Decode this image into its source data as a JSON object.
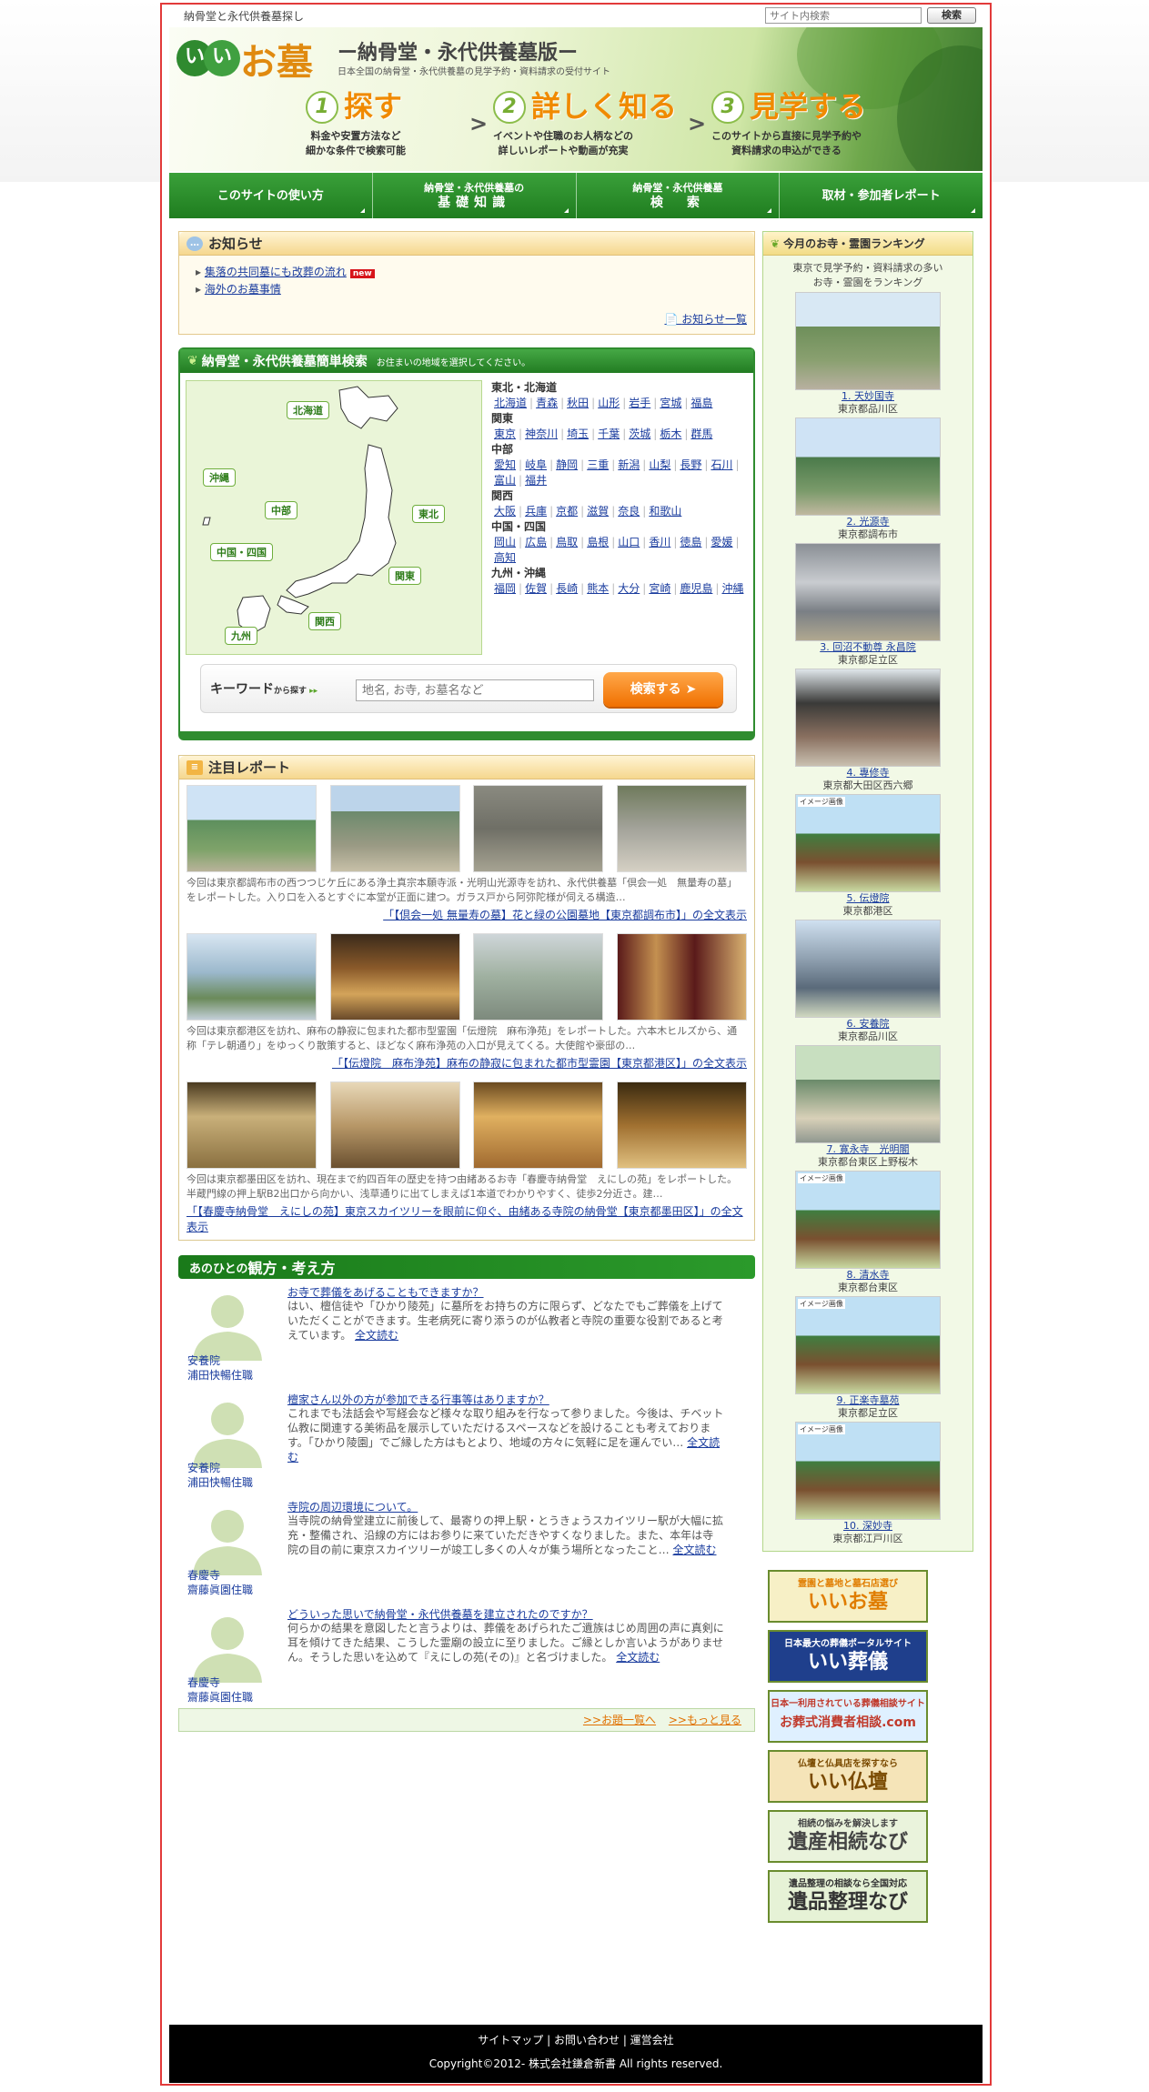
{
  "topbar": {
    "tagline": "納骨堂と永代供養墓探し",
    "search_placeholder": "サイト内検索",
    "search_button": "検索"
  },
  "header": {
    "logo_circle": "いい",
    "logo_text": "お墓",
    "subtitle": "ー納骨堂・永代供養墓版ー",
    "description": "日本全国の納骨堂・永代供養墓の見学予約・資料請求の受付サイト",
    "steps": [
      {
        "num": "1",
        "title": "探す",
        "desc1": "料金や安置方法など",
        "desc2": "細かな条件で検索可能"
      },
      {
        "num": "2",
        "title": "詳しく知る",
        "desc1": "イベントや住職のお人柄などの",
        "desc2": "詳しいレポートや動画が充実"
      },
      {
        "num": "3",
        "title": "見学する",
        "desc1": "このサイトから直接に見学予約や",
        "desc2": "資料請求の申込ができる"
      }
    ]
  },
  "gnav": [
    {
      "l1": "このサイトの使い方",
      "l2": ""
    },
    {
      "l1": "納骨堂・永代供養墓の",
      "l2": "基礎知識"
    },
    {
      "l1": "納骨堂・永代供養墓",
      "l2": "検　索"
    },
    {
      "l1": "取材・参加者レポート",
      "l2": ""
    }
  ],
  "news": {
    "title": "お知らせ",
    "items": [
      "集落の共同墓にも改葬の流れ",
      "海外のお墓事情"
    ],
    "new_badge": "new",
    "more": "お知らせ一覧"
  },
  "search": {
    "title": "納骨堂・永代供養墓簡単検索",
    "hint": "お住まいの地域を選択してください。",
    "map_labels": [
      "北海道",
      "沖縄",
      "中部",
      "東北",
      "中国・四国",
      "関東",
      "関西",
      "九州"
    ],
    "regions": [
      {
        "name": "東北・北海道",
        "prefs": [
          "北海道",
          "青森",
          "秋田",
          "山形",
          "岩手",
          "宮城",
          "福島"
        ]
      },
      {
        "name": "関東",
        "prefs": [
          "東京",
          "神奈川",
          "埼玉",
          "千葉",
          "茨城",
          "栃木",
          "群馬"
        ]
      },
      {
        "name": "中部",
        "prefs": [
          "愛知",
          "岐阜",
          "静岡",
          "三重",
          "新潟",
          "山梨",
          "長野",
          "石川",
          "富山",
          "福井"
        ]
      },
      {
        "name": "関西",
        "prefs": [
          "大阪",
          "兵庫",
          "京都",
          "滋賀",
          "奈良",
          "和歌山"
        ]
      },
      {
        "name": "中国・四国",
        "prefs": [
          "岡山",
          "広島",
          "鳥取",
          "島根",
          "山口",
          "香川",
          "徳島",
          "愛媛",
          "高知"
        ]
      },
      {
        "name": "九州・沖縄",
        "prefs": [
          "福岡",
          "佐賀",
          "長崎",
          "熊本",
          "大分",
          "宮崎",
          "鹿児島",
          "沖縄"
        ]
      }
    ],
    "keyword_label": "キーワード",
    "keyword_small": "から探す",
    "keyword_placeholder": "地名, お寺, お墓名など",
    "button": "検索する"
  },
  "reports": {
    "title": "注目レポート",
    "items": [
      {
        "text": "今回は東京都調布市の西つつじケ丘にある浄土真宗本願寺派・光明山光源寺を訪れ、永代供養墓「倶会一処　無量寿の墓」をレポートした。入り口を入るとすぐに本堂が正面に建つ。ガラス戸から阿弥陀様が伺える構造…",
        "link": "「【倶会一処 無量寿の墓】花と緑の公園墓地【東京都調布市】」の全文表示"
      },
      {
        "text": "今回は東京都港区を訪れ、麻布の静寂に包まれた都市型霊園「伝燈院　麻布浄苑」をレポートした。六本木ヒルズから、通称「テレ朝通り」をゆっくり散策すると、ほどなく麻布浄苑の入口が見えてくる。大使館や豪邸の…",
        "link": "「【伝燈院　麻布浄苑】麻布の静寂に包まれた都市型霊園【東京都港区】」の全文表示"
      },
      {
        "text": "今回は東京都墨田区を訪れ、現在まで約四百年の歴史を持つ由緒あるお寺「春慶寺納骨堂　えにしの苑」をレポートした。半蔵門線の押上駅B2出口から向かい、浅草通りに出てしまえば1本道でわかりやすく、徒歩2分近さ。建…",
        "link": "「【春慶寺納骨堂　えにしの苑】東京スカイツリーを眼前に仰ぐ、由緒ある寺院の納骨堂【東京都墨田区】」の全文表示"
      }
    ]
  },
  "views": {
    "title_small": "あのひとの",
    "title_big": "観方・考え方",
    "items": [
      {
        "q": "お寺で葬儀をあげることもできますか？",
        "a": "はい、檀信徒や「ひかり陵苑」に墓所をお持ちの方に限らず、どなたでもご葬儀を上げていただくことができます。生老病死に寄り添うのが仏教者と寺院の重要な役割であると考えています。",
        "more": "全文読む",
        "who1": "安養院",
        "who2": "浦田快暢住職"
      },
      {
        "q": "檀家さん以外の方が参加できる行事等はありますか？",
        "a": "これまでも法話会や写経会など様々な取り組みを行なって参りました。今後は、チベット仏教に関連する美術品を展示していただけるスペースなどを設けることも考えております。「ひかり陵園」でご縁した方はもとより、地域の方々に気軽に足を運んでい…",
        "more": "全文読む",
        "who1": "安養院",
        "who2": "浦田快暢住職"
      },
      {
        "q": "寺院の周辺環境について。",
        "a": "当寺院の納骨堂建立に前後して、最寄りの押上駅・とうきょうスカイツリー駅が大幅に拡充・整備され、沿線の方にはお参りに来ていただきやすくなりました。また、本年は寺院の目の前に東京スカイツリーが竣工し多くの人々が集う場所となったこと…",
        "more": "全文読む",
        "who1": "春慶寺",
        "who2": "齋藤眞園住職"
      },
      {
        "q": "どういった思いで納骨堂・永代供養墓を建立されたのですか？",
        "a": "何らかの結果を意図したと言うよりは、葬儀をあげられたご遺族はじめ周囲の声に真剣に耳を傾けてきた結果、こうした霊廟の設立に至りました。ご縁としか言いようがありません。そうした思いを込めて『えにしの苑(その)』と名づけました。",
        "more": "全文読む",
        "who1": "春慶寺",
        "who2": "齋藤眞園住職"
      }
    ],
    "foot_list": ">>お題一覧へ",
    "foot_more": ">>もっと見る"
  },
  "ranking": {
    "title": "今月のお寺・霊園ランキング",
    "intro1": "東京で見学予約・資料請求の多い",
    "intro2": "お寺・霊園をランキング",
    "items": [
      {
        "name": "1. 天妙国寺",
        "loc": "東京都品川区"
      },
      {
        "name": "2. 光源寺",
        "loc": "東京都調布市"
      },
      {
        "name": "3. 回沼不動尊 永昌院",
        "loc": "東京都足立区"
      },
      {
        "name": "4. 專修寺",
        "loc": "東京都大田区西六郷"
      },
      {
        "name": "5. 伝燈院",
        "loc": "東京都港区"
      },
      {
        "name": "6. 安養院",
        "loc": "東京都品川区"
      },
      {
        "name": "7. 寛永寺　光明閣",
        "loc": "東京都台東区上野桜木"
      },
      {
        "name": "8. 清水寺",
        "loc": "東京都台東区"
      },
      {
        "name": "9. 正楽寺墓苑",
        "loc": "東京都足立区"
      },
      {
        "name": "10. 深妙寺",
        "loc": "東京都江戸川区"
      }
    ],
    "image_badge": "イメージ画像"
  },
  "banners": [
    {
      "t1": "霊園と墓地と墓石店選び",
      "t2": "いいお墓",
      "bg": "#f7f0c6",
      "fg": "#e07d00"
    },
    {
      "t1": "日本最大の葬儀ポータルサイト",
      "t2": "いい葬儀",
      "bg": "#1f3f8c",
      "fg": "#ffffff"
    },
    {
      "t1": "日本一利用されている葬儀相談サイト",
      "t2": "お葬式消費者相談.com",
      "bg": "#dff0ff",
      "fg": "#c0392b"
    },
    {
      "t1": "仏壇と仏具店を探すなら",
      "t2": "いい仏壇",
      "bg": "#f5e4b8",
      "fg": "#7a4a00"
    },
    {
      "t1": "相続の悩みを解決します",
      "t2": "遺産相続なび",
      "bg": "#eaf3dc",
      "fg": "#444444"
    },
    {
      "t1": "遺品整理の相談なら全国対応",
      "t2": "遺品整理なび",
      "bg": "#e6f2d6",
      "fg": "#333333"
    }
  ],
  "footer": {
    "links": [
      "サイトマップ",
      "お問い合わせ",
      "運営会社"
    ],
    "copyright": "Copyright©2012- 株式会社鎌倉新書 All rights reserved."
  }
}
